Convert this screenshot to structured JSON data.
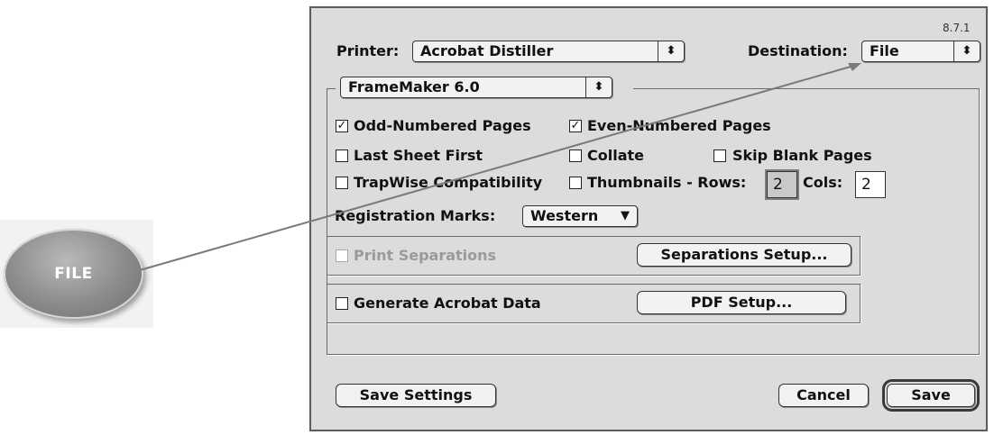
{
  "version": "8.7.1",
  "callout": {
    "label": "FILE"
  },
  "printer": {
    "label": "Printer:",
    "value": "Acrobat Distiller"
  },
  "destination": {
    "label": "Destination:",
    "value": "File"
  },
  "plugin_popup": {
    "value": "FrameMaker 6.0"
  },
  "options": {
    "odd_pages": {
      "label": "Odd-Numbered Pages",
      "checked": true
    },
    "even_pages": {
      "label": "Even-Numbered Pages",
      "checked": true
    },
    "last_sheet_first": {
      "label": "Last Sheet First",
      "checked": false
    },
    "collate": {
      "label": "Collate",
      "checked": false
    },
    "skip_blank": {
      "label": "Skip Blank Pages",
      "checked": false
    },
    "trapwise": {
      "label": "TrapWise Compatibility",
      "checked": false
    },
    "thumbnails": {
      "label": "Thumbnails - Rows:",
      "checked": false
    },
    "rows_value": "2",
    "cols_label": "Cols:",
    "cols_value": "2"
  },
  "registration": {
    "label": "Registration Marks:",
    "value": "Western"
  },
  "separations": {
    "label": "Print Separations",
    "checked": false,
    "enabled": false,
    "button": "Separations Setup..."
  },
  "acrobat": {
    "label": "Generate Acrobat Data",
    "checked": false,
    "button": "PDF Setup..."
  },
  "footer": {
    "save_settings": "Save Settings",
    "cancel": "Cancel",
    "save": "Save"
  },
  "icons": {
    "checkbox_checked": "checkmark-icon",
    "popup_arrows": "updown-arrows-icon",
    "dropdown": "triangle-down-icon"
  },
  "colors": {
    "dialog_bg": "#dcdcdc",
    "callout": "#8a8a8a"
  }
}
